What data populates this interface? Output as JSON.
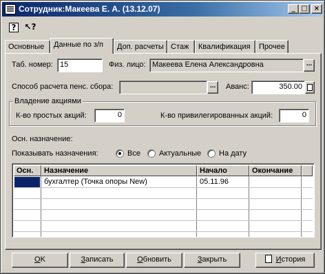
{
  "window": {
    "title": "Сотрудник:Макеева Е. А. (13.12.07)",
    "minimize": "_",
    "maximize": "□",
    "close": "×"
  },
  "toolbar": {
    "help_glyph": "?",
    "whatis_glyph": "↖?"
  },
  "tabs": [
    {
      "label": "Основные"
    },
    {
      "label": "Данные по з/п"
    },
    {
      "label": "Доп. расчеты"
    },
    {
      "label": "Стаж"
    },
    {
      "label": "Квалификация"
    },
    {
      "label": "Прочее"
    }
  ],
  "form": {
    "tab_number_label": "Таб. номер:",
    "tab_number_value": "15",
    "person_label": "Физ. лицо:",
    "person_value": "Макеева Елена Александровна",
    "pension_label": "Способ расчета пенс. сбора:",
    "pension_value": "",
    "advance_label": "Аванс:",
    "advance_value": "350.00",
    "shares_title": "Владение акциями",
    "simple_shares_label": "К-во простых акций:",
    "simple_shares_value": "0",
    "pref_shares_label": "К-во привилегированных акций:",
    "pref_shares_value": "0",
    "main_assignment_label": "Осн. назначение:",
    "show_assignments_label": "Показывать назначения:",
    "radio_all": "Все",
    "radio_actual": "Актуальные",
    "radio_date": "На дату",
    "selected_radio": "all"
  },
  "grid": {
    "columns": [
      "Осн.",
      "Назначение",
      "Начало",
      "Окончание"
    ],
    "rows": [
      {
        "main": "",
        "assignment": "бухгалтер (Точка опоры New)",
        "start": "05.11.96",
        "end": ""
      }
    ]
  },
  "buttons": {
    "ok_u": "О",
    "ok_rest": "K",
    "write_u": "З",
    "write_rest": "аписать",
    "refresh_u": "О",
    "refresh_rest": "бновить",
    "close_u": "З",
    "close_rest": "акрыть",
    "history_u": "И",
    "history_rest": "стория"
  },
  "colors": {
    "titlebar": "#0a246a",
    "face": "#d4d0c8",
    "selection": "#0a246a"
  }
}
